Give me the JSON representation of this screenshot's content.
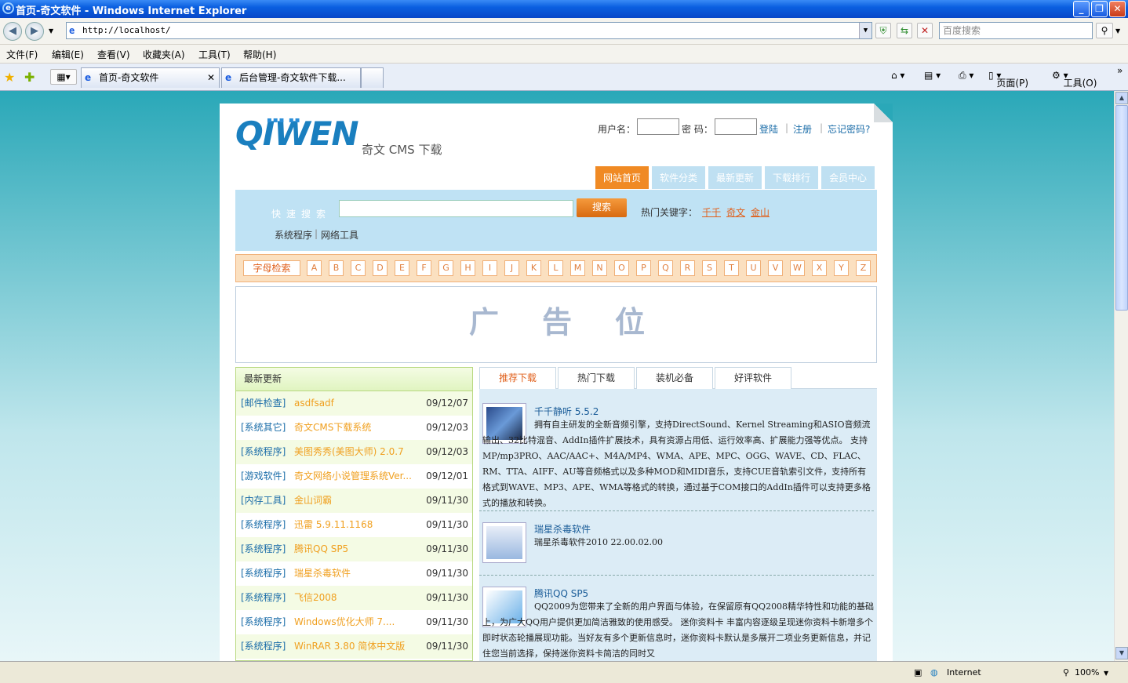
{
  "window": {
    "title": "首页-奇文软件 - Windows Internet Explorer",
    "ie_icon": "e"
  },
  "addressbar": {
    "url": "http://localhost/",
    "search_placeholder": "百度搜索"
  },
  "menu": [
    "文件(F)",
    "编辑(E)",
    "查看(V)",
    "收藏夹(A)",
    "工具(T)",
    "帮助(H)"
  ],
  "tabs": [
    {
      "label": "首页-奇文软件"
    },
    {
      "label": "后台管理-奇文软件下载..."
    }
  ],
  "right_tools": {
    "page": "页面(P)",
    "tools": "工具(O)"
  },
  "status": {
    "zone": "Internet",
    "zoom": "100%"
  },
  "site": {
    "logo": "QIWEN",
    "logo_dots": "▪▪▪ ▪▪",
    "subtitle": "奇文 CMS 下载",
    "login": {
      "username_label": "用户名：",
      "password_label": "密  码：",
      "login": "登陆",
      "register": "注册",
      "forgot": "忘记密码?"
    },
    "nav": [
      "网站首页",
      "软件分类",
      "最新更新",
      "下载排行",
      "会员中心"
    ],
    "search": {
      "label": "快速搜索",
      "button": "搜索",
      "hot_label": "热门关键字：",
      "keywords": [
        "千千",
        "奇文",
        "金山"
      ],
      "categories": [
        "系统程序",
        "网络工具"
      ]
    },
    "letters_label": "字母检索",
    "letters": [
      "A",
      "B",
      "C",
      "D",
      "E",
      "F",
      "G",
      "H",
      "I",
      "J",
      "K",
      "L",
      "M",
      "N",
      "O",
      "P",
      "Q",
      "R",
      "S",
      "T",
      "U",
      "V",
      "W",
      "X",
      "Y",
      "Z"
    ],
    "ad": "广告位",
    "latest": {
      "title": "最新更新",
      "rows": [
        {
          "cat": "[邮件检查]",
          "name": "asdfsadf",
          "date": "09/12/07"
        },
        {
          "cat": "[系统其它]",
          "name": "奇文CMS下载系统",
          "date": "09/12/03"
        },
        {
          "cat": "[系统程序]",
          "name": "美图秀秀(美图大师) 2.0.7",
          "date": "09/12/03"
        },
        {
          "cat": "[游戏软件]",
          "name": "奇文网络小说管理系统Ver...",
          "date": "09/12/01"
        },
        {
          "cat": "[内存工具]",
          "name": "金山词霸",
          "date": "09/11/30"
        },
        {
          "cat": "[系统程序]",
          "name": "迅雷 5.9.11.1168",
          "date": "09/11/30"
        },
        {
          "cat": "[系统程序]",
          "name": "腾讯QQ SP5",
          "date": "09/11/30"
        },
        {
          "cat": "[系统程序]",
          "name": "瑞星杀毒软件",
          "date": "09/11/30"
        },
        {
          "cat": "[系统程序]",
          "name": "飞信2008",
          "date": "09/11/30"
        },
        {
          "cat": "[系统程序]",
          "name": "Windows优化大师 7....",
          "date": "09/11/30"
        },
        {
          "cat": "[系统程序]",
          "name": "WinRAR 3.80 简体中文版",
          "date": "09/11/30"
        }
      ]
    },
    "recommend": {
      "tabs": [
        "推荐下载",
        "热门下载",
        "装机必备",
        "好评软件"
      ],
      "items": [
        {
          "title": "千千静听 5.5.2",
          "desc": "拥有自主研发的全新音频引擎，支持DirectSound、Kernel Streaming和ASIO音频流输出、32比特混音、AddIn插件扩展技术，具有资源占用低、运行效率高、扩展能力强等优点。 支持MP/mp3PRO、AAC/AAC+、M4A/MP4、WMA、APE、MPC、OGG、WAVE、CD、FLAC、RM、TTA、AIFF、AU等音频格式以及多种MOD和MIDI音乐，支持CUE音轨索引文件，支持所有格式到WAVE、MP3、APE、WMA等格式的转换，通过基于COM接口的AddIn插件可以支持更多格式的播放和转换。"
        },
        {
          "title": "瑞星杀毒软件",
          "desc": "瑞星杀毒软件2010 22.00.02.00"
        },
        {
          "title": "腾讯QQ SP5",
          "desc": "QQ2009为您带来了全新的用户界面与体验，在保留原有QQ2008精华特性和功能的基础上，为广大QQ用户提供更加简洁雅致的使用感受。 迷你资料卡 丰富内容逐级呈现迷你资料卡新增多个即时状态轮播展现功能。当好友有多个更新信息时，迷你资料卡默认是多展开二项业务更新信息，并记住您当前选择，保持迷你资料卡简洁的同时又"
        }
      ]
    }
  }
}
